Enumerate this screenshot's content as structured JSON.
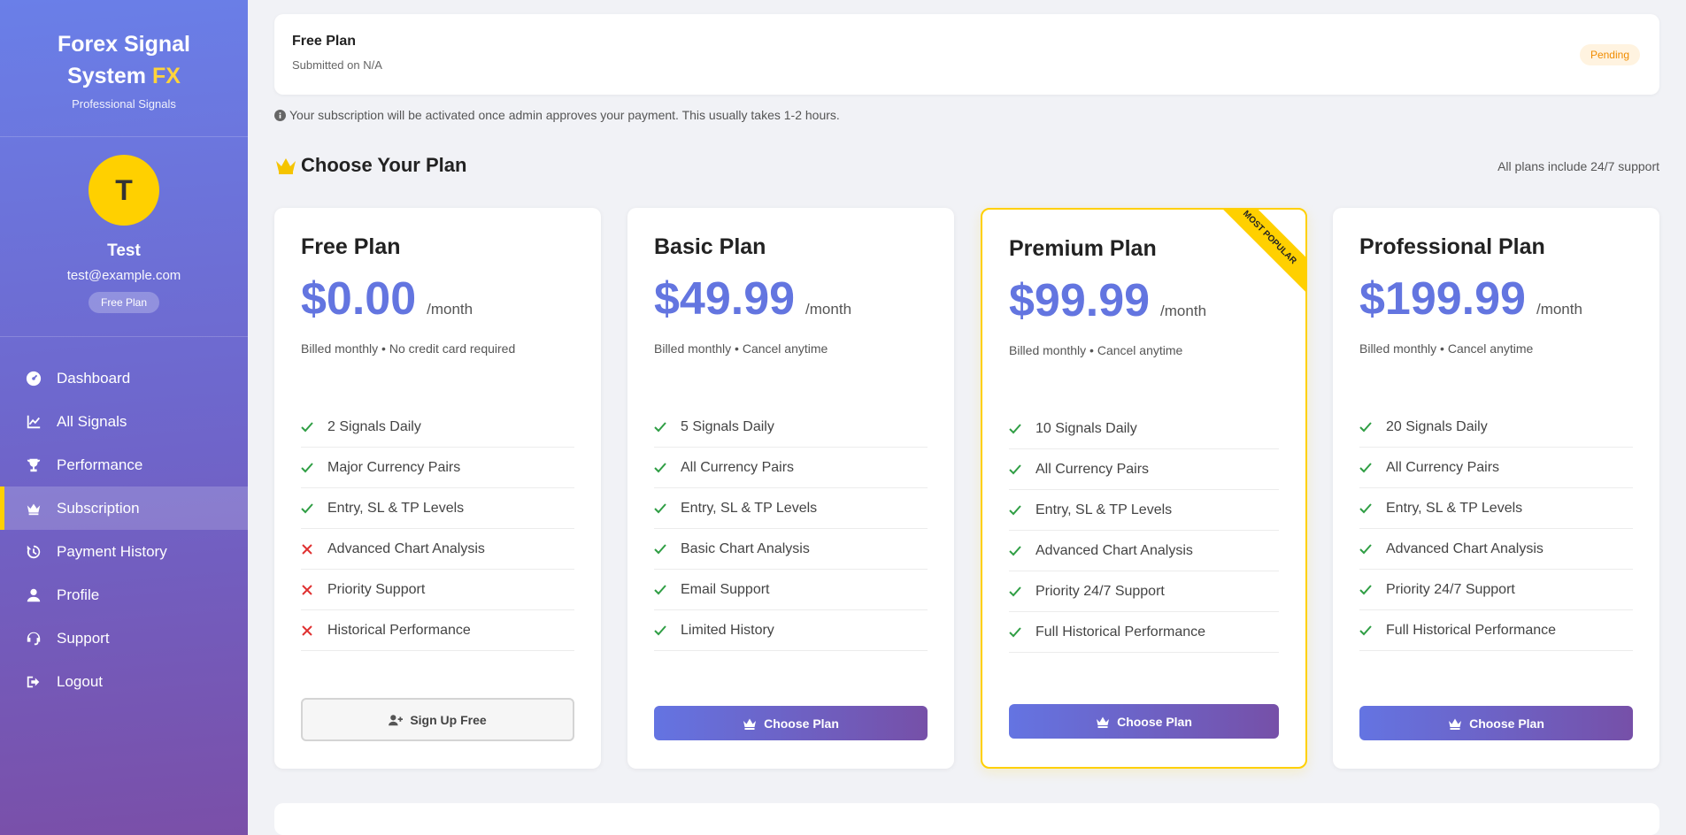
{
  "sidebar": {
    "brand_line1": "Forex Signal",
    "brand_line2": "System",
    "brand_fx": "FX",
    "brand_sub": "Professional Signals",
    "avatar_initial": "T",
    "user_name": "Test",
    "user_email": "test@example.com",
    "plan_pill": "Free Plan",
    "items": [
      {
        "label": "Dashboard",
        "icon": "dashboard-icon"
      },
      {
        "label": "All Signals",
        "icon": "chart-line-icon"
      },
      {
        "label": "Performance",
        "icon": "trophy-icon"
      },
      {
        "label": "Subscription",
        "icon": "crown-icon",
        "active": true
      },
      {
        "label": "Payment History",
        "icon": "history-icon"
      },
      {
        "label": "Profile",
        "icon": "user-icon"
      },
      {
        "label": "Support",
        "icon": "headset-icon"
      },
      {
        "label": "Logout",
        "icon": "logout-icon"
      }
    ]
  },
  "status": {
    "title": "Free Plan",
    "date": "Submitted on N/A",
    "badge": "Pending"
  },
  "notice": "Your subscription will be activated once admin approves your payment. This usually takes 1-2 hours.",
  "section": {
    "title": "Choose Your Plan",
    "note": "All plans include 24/7 support"
  },
  "colors": {
    "accent": "#6375e0",
    "highlight": "#ffd000",
    "check": "#2f9e44",
    "cross": "#e03131"
  },
  "plans": [
    {
      "name": "Free Plan",
      "price": "$0.00",
      "per": "/month",
      "billed": "Billed monthly • No credit card required",
      "features": [
        {
          "text": "2 Signals Daily",
          "included": true
        },
        {
          "text": "Major Currency Pairs",
          "included": true
        },
        {
          "text": "Entry, SL & TP Levels",
          "included": true
        },
        {
          "text": "Advanced Chart Analysis",
          "included": false
        },
        {
          "text": "Priority Support",
          "included": false
        },
        {
          "text": "Historical Performance",
          "included": false
        }
      ],
      "button": "Sign Up Free"
    },
    {
      "name": "Basic Plan",
      "price": "$49.99",
      "per": "/month",
      "billed": "Billed monthly • Cancel anytime",
      "features": [
        {
          "text": "5 Signals Daily",
          "included": true
        },
        {
          "text": "All Currency Pairs",
          "included": true
        },
        {
          "text": "Entry, SL & TP Levels",
          "included": true
        },
        {
          "text": "Basic Chart Analysis",
          "included": true
        },
        {
          "text": "Email Support",
          "included": true
        },
        {
          "text": "Limited History",
          "included": true
        }
      ],
      "button": "Choose Plan"
    },
    {
      "name": "Premium Plan",
      "price": "$99.99",
      "per": "/month",
      "billed": "Billed monthly • Cancel anytime",
      "ribbon": "MOST POPULAR",
      "features": [
        {
          "text": "10 Signals Daily",
          "included": true
        },
        {
          "text": "All Currency Pairs",
          "included": true
        },
        {
          "text": "Entry, SL & TP Levels",
          "included": true
        },
        {
          "text": "Advanced Chart Analysis",
          "included": true
        },
        {
          "text": "Priority 24/7 Support",
          "included": true
        },
        {
          "text": "Full Historical Performance",
          "included": true
        }
      ],
      "button": "Choose Plan"
    },
    {
      "name": "Professional Plan",
      "price": "$199.99",
      "per": "/month",
      "billed": "Billed monthly • Cancel anytime",
      "features": [
        {
          "text": "20 Signals Daily",
          "included": true
        },
        {
          "text": "All Currency Pairs",
          "included": true
        },
        {
          "text": "Entry, SL & TP Levels",
          "included": true
        },
        {
          "text": "Advanced Chart Analysis",
          "included": true
        },
        {
          "text": "Priority 24/7 Support",
          "included": true
        },
        {
          "text": "Full Historical Performance",
          "included": true
        }
      ],
      "button": "Choose Plan"
    }
  ]
}
